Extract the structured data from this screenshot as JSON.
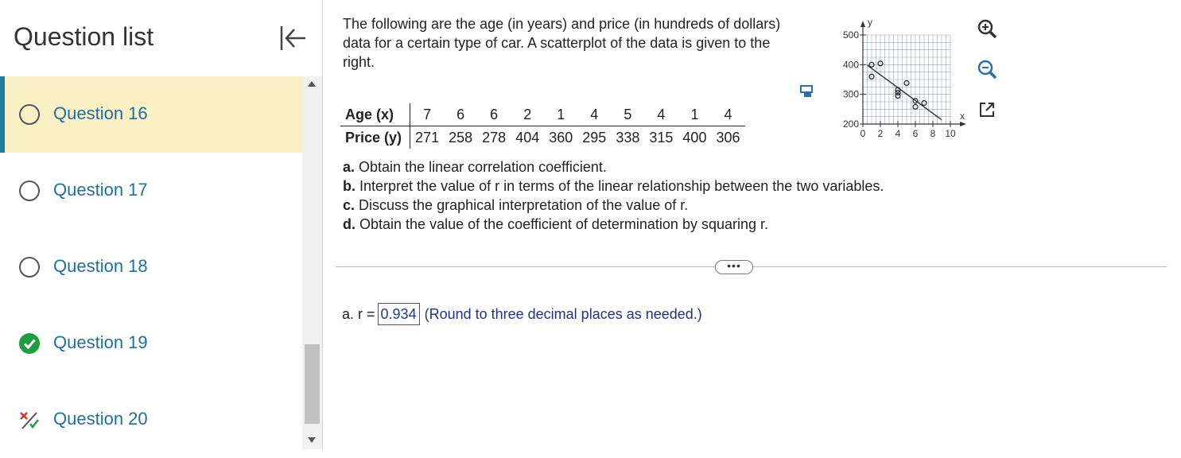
{
  "sidebar": {
    "title": "Question list",
    "items": [
      {
        "label": "Question 16",
        "status": "unanswered",
        "active": true
      },
      {
        "label": "Question 17",
        "status": "unanswered",
        "active": false
      },
      {
        "label": "Question 18",
        "status": "unanswered",
        "active": false
      },
      {
        "label": "Question 19",
        "status": "correct",
        "active": false
      },
      {
        "label": "Question 20",
        "status": "partially-correct",
        "active": false
      }
    ]
  },
  "question": {
    "prompt": "The following are the age (in years) and price (in hundreds of dollars) data for a certain type of car. A scatterplot of the data is given to the right.",
    "table": {
      "row_labels": [
        "Age (x)",
        "Price (y)"
      ],
      "ages": [
        "7",
        "6",
        "6",
        "2",
        "1",
        "4",
        "5",
        "4",
        "1",
        "4"
      ],
      "prices": [
        "271",
        "258",
        "278",
        "404",
        "360",
        "295",
        "338",
        "315",
        "400",
        "306"
      ]
    },
    "parts": [
      {
        "tag": "a.",
        "text": "Obtain the linear correlation coefficient."
      },
      {
        "tag": "b.",
        "text": "Interpret the value of r in terms of the linear relationship between the two variables."
      },
      {
        "tag": "c.",
        "text": "Discuss the graphical interpretation of the value of r."
      },
      {
        "tag": "d.",
        "text": "Obtain the value of the coefficient of determination by squaring r."
      }
    ],
    "more_label": "•••",
    "answer": {
      "label": "a. r =",
      "value": "0.934",
      "hint": "(Round to three decimal places as needed.)"
    }
  },
  "chart_data": {
    "type": "scatter",
    "xlabel": "x",
    "ylabel": "y",
    "xlim": [
      0,
      10
    ],
    "ylim": [
      200,
      500
    ],
    "x_ticks": [
      "0",
      "2",
      "4",
      "6",
      "8",
      "10"
    ],
    "y_ticks": [
      "200",
      "300",
      "400",
      "500"
    ],
    "grid": true,
    "points": [
      {
        "x": 7,
        "y": 271
      },
      {
        "x": 6,
        "y": 258
      },
      {
        "x": 6,
        "y": 278
      },
      {
        "x": 2,
        "y": 404
      },
      {
        "x": 1,
        "y": 360
      },
      {
        "x": 4,
        "y": 295
      },
      {
        "x": 5,
        "y": 338
      },
      {
        "x": 4,
        "y": 315
      },
      {
        "x": 1,
        "y": 400
      },
      {
        "x": 4,
        "y": 306
      }
    ],
    "has_regression_line": true
  },
  "colors": {
    "accent": "#1e7da0",
    "active_bg": "#fbf0c6",
    "link_text": "#1d6ea3",
    "correct": "#1e9e3e",
    "answer_text": "#1d3a8a"
  },
  "icons": {
    "collapse": "collapse-left-icon",
    "copy": "copy-icon",
    "zoom_in": "zoom-in-icon",
    "zoom_out": "zoom-out-icon",
    "expand": "expand-icon"
  }
}
